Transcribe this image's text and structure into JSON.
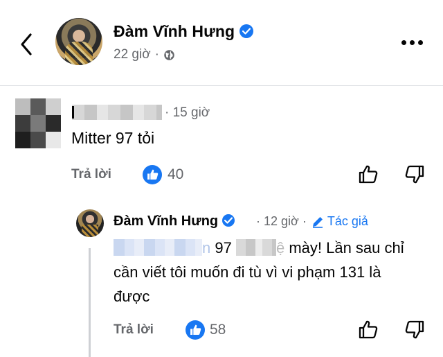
{
  "header": {
    "name": "Đàm Vĩnh Hưng",
    "time": "22 giờ",
    "separator": "·"
  },
  "comment": {
    "time": "· 15 giờ",
    "text": "Mitter 97 tỏi",
    "reply_label": "Trả lời",
    "likes": "40"
  },
  "reply": {
    "name": "Đàm Vĩnh Hưng",
    "time": "· 12 giờ ·",
    "author_label": "Tác giả",
    "text_part1_tail": "n",
    "text_part2": " 97 ",
    "text_part3": "ệ",
    "text_part4": " mày! Lần sau chỉ cần viết tôi muốn đi tù vì vi phạm 131 là được",
    "reply_label": "Trả lời",
    "likes": "58"
  },
  "colors": {
    "accent": "#1877f2",
    "muted": "#65676b",
    "text": "#050505"
  },
  "icons": [
    "back-arrow-icon",
    "verified-badge-icon",
    "globe-icon",
    "more-options-icon",
    "like-badge-icon",
    "thumbs-up-icon",
    "thumbs-down-icon",
    "pencil-icon"
  ]
}
